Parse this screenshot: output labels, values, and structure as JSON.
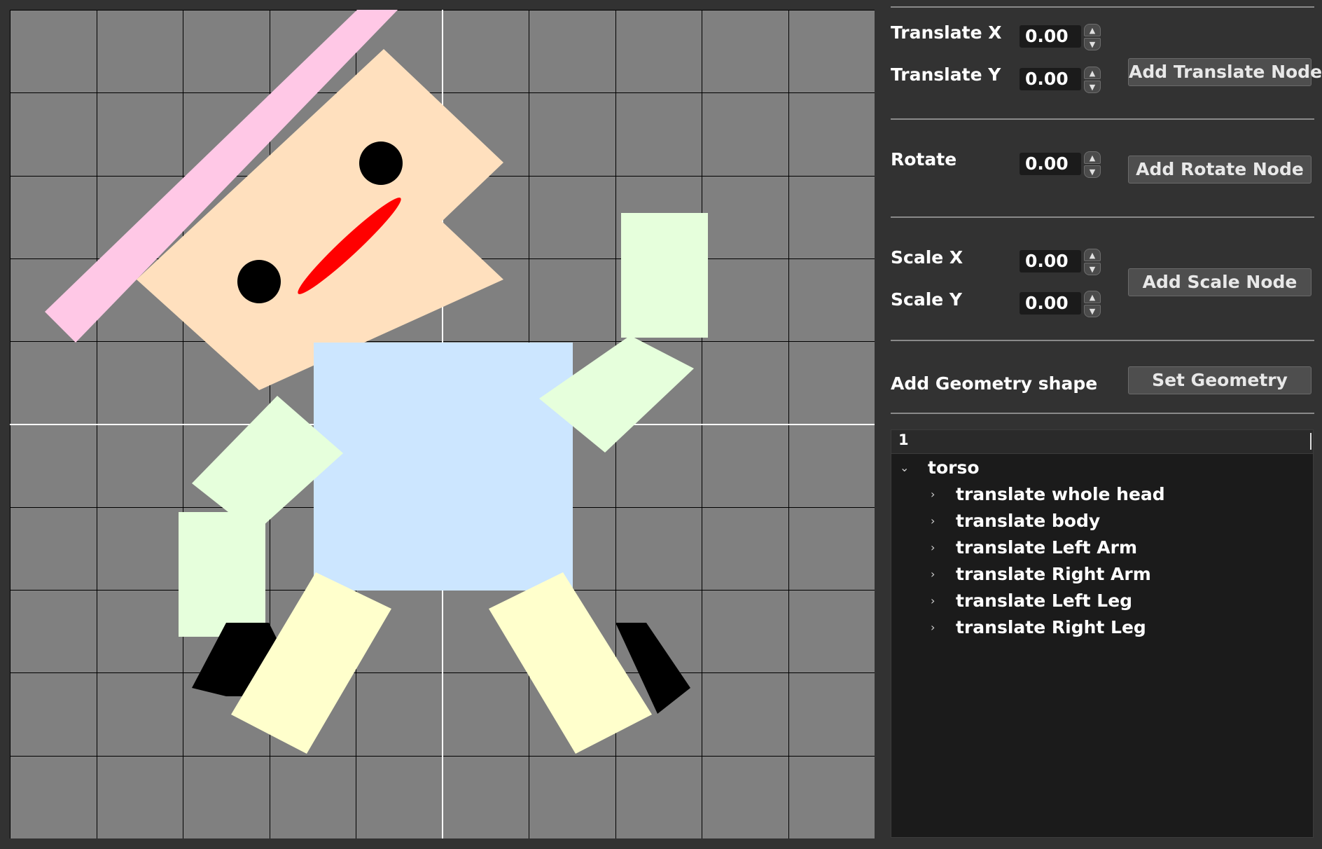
{
  "canvas": {
    "background": "#808080",
    "grid_color": "#000000",
    "axis_color": "#ffffff",
    "colors": {
      "hat": "#ffc8e6",
      "skin": "#ffe0be",
      "eye": "#000000",
      "mouth": "#ff0000",
      "torso": "#cce6ff",
      "arm": "#e6ffdc",
      "leg": "#ffffcc",
      "shoe": "#000000"
    }
  },
  "controls": {
    "translate_x": {
      "label": "Translate X",
      "value": "0.00"
    },
    "translate_y": {
      "label": "Translate Y",
      "value": "0.00"
    },
    "add_translate_button": "Add Translate Node",
    "rotate": {
      "label": "Rotate",
      "value": "0.00"
    },
    "add_rotate_button": "Add Rotate Node",
    "scale_x": {
      "label": "Scale X",
      "value": "0.00"
    },
    "scale_y": {
      "label": "Scale Y",
      "value": "0.00"
    },
    "add_scale_button": "Add Scale Node",
    "geometry_label": "Add Geometry shape",
    "set_geometry_button": "Set Geometry"
  },
  "tree": {
    "column_header": "1",
    "root": "torso",
    "children": [
      "translate whole head",
      "translate body",
      "translate Left Arm",
      "translate Right Arm",
      "translate Left Leg",
      "translate Right Leg"
    ]
  }
}
